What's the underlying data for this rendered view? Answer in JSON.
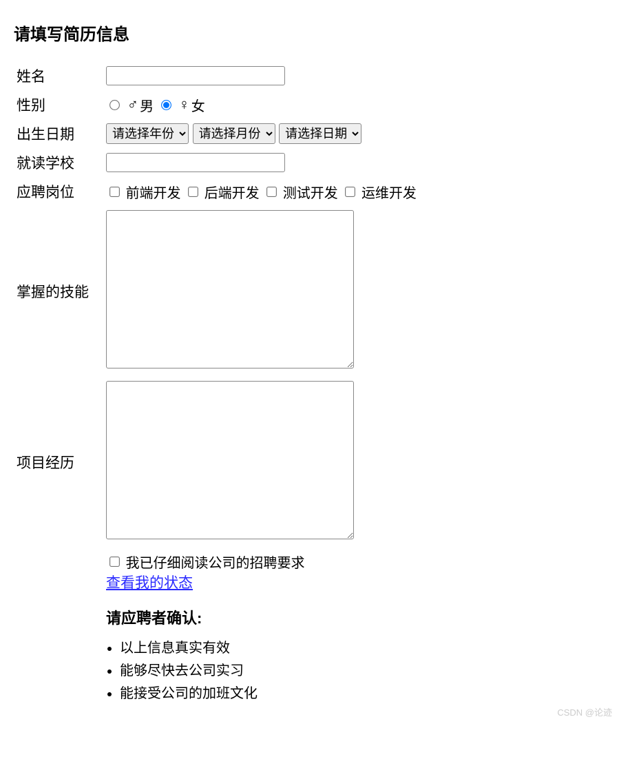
{
  "title": "请填写简历信息",
  "labels": {
    "name": "姓名",
    "gender": "性别",
    "birth": "出生日期",
    "school": "就读学校",
    "position": "应聘岗位",
    "skills": "掌握的技能",
    "projects": "项目经历"
  },
  "gender": {
    "male": "男",
    "female": "女",
    "selected": "female"
  },
  "birth": {
    "year_placeholder": "请选择年份",
    "month_placeholder": "请选择月份",
    "day_placeholder": "请选择日期"
  },
  "positions": [
    "前端开发",
    "后端开发",
    "测试开发",
    "运维开发"
  ],
  "agree_label": "我已仔细阅读公司的招聘要求",
  "status_link": "查看我的状态",
  "confirm_title": "请应聘者确认:",
  "confirm_items": [
    "以上信息真实有效",
    "能够尽快去公司实习",
    "能接受公司的加班文化"
  ],
  "watermark": "CSDN @论迹"
}
